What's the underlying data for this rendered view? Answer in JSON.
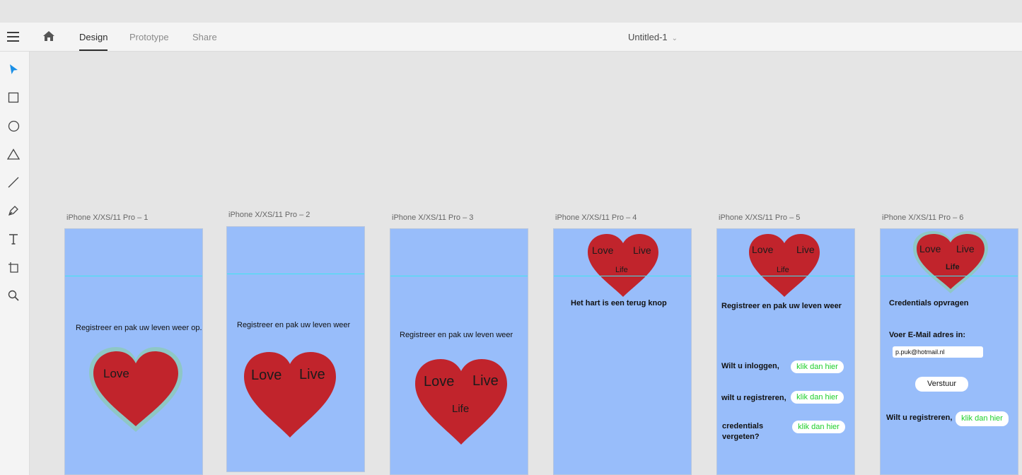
{
  "app": {
    "tabs": [
      "Design",
      "Prototype",
      "Share"
    ],
    "active_tab": "Design",
    "document_title": "Untitled-1"
  },
  "toolbar": {
    "tools": [
      "select-icon",
      "rectangle-icon",
      "ellipse-icon",
      "polygon-icon",
      "line-icon",
      "pen-icon",
      "text-icon",
      "artboard-icon",
      "zoom-icon"
    ]
  },
  "colors": {
    "artboard_fill": "#98bdfa",
    "heart": "#c1242c",
    "heart_glow": "#8ec7c5",
    "guide": "#3ee6f0",
    "button_text": "#1ecf2a"
  },
  "artboards": [
    {
      "label": "iPhone X/XS/11 Pro – 1",
      "text": "Registreer en pak uw leven weer op.",
      "heart": {
        "words": [
          "Love"
        ]
      }
    },
    {
      "label": "iPhone X/XS/11 Pro – 2",
      "text": "Registreer en pak uw leven weer",
      "heart": {
        "words": [
          "Love",
          "Live"
        ]
      }
    },
    {
      "label": "iPhone X/XS/11 Pro – 3",
      "text": "Registreer en pak uw leven weer",
      "heart": {
        "words": [
          "Love",
          "Live",
          "Life"
        ]
      }
    },
    {
      "label": "iPhone X/XS/11 Pro – 4",
      "text": "Het hart is een terug knop",
      "heart": {
        "words": [
          "Love",
          "Live",
          "Life"
        ]
      }
    },
    {
      "label": "iPhone X/XS/11 Pro – 5",
      "text": "Registreer en pak uw leven weer",
      "heart": {
        "words": [
          "Love",
          "Live",
          "Life"
        ]
      },
      "rows": [
        {
          "label": "Wilt u inloggen,",
          "button": "klik dan hier"
        },
        {
          "label": "wilt u registreren,",
          "button": "klik dan hier"
        },
        {
          "label": "credentials\nvergeten?",
          "button": "klik dan hier"
        }
      ]
    },
    {
      "label": "iPhone X/XS/11 Pro – 6",
      "heart": {
        "words": [
          "Love",
          "Live",
          "Life"
        ]
      },
      "heading": "Credentials opvragen",
      "email_label": "Voer E-Mail adres in:",
      "email_value": "p.puk@hotmail.nl",
      "submit": "Verstuur",
      "register_label": "Wilt u registreren,",
      "register_button": "klik dan hier"
    }
  ]
}
